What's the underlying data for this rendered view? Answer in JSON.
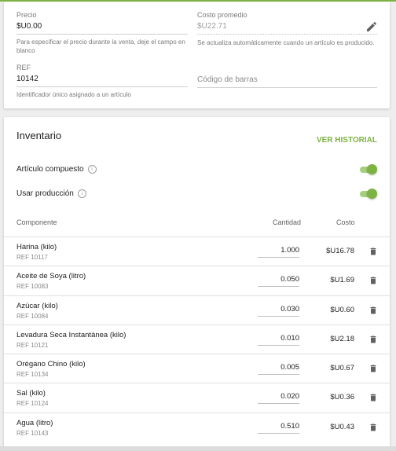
{
  "pricing": {
    "price_label": "Precio",
    "price_value": "$U0.00",
    "price_hint": "Para especificar el precio durante la venta, deje el campo en blanco",
    "avg_cost_label": "Costo promedio",
    "avg_cost_value": "$U22.71",
    "avg_cost_hint": "Se actualiza automáticamente cuando un artículo es producido.",
    "ref_label": "REF",
    "ref_value": "10142",
    "ref_hint": "Identificador único asignado a un artículo",
    "barcode_placeholder": "Código de barras"
  },
  "inventory": {
    "title": "Inventario",
    "history_link": "VER HISTORIAL",
    "composite_label": "Artículo compuesto",
    "composite_on": true,
    "production_label": "Usar producción",
    "production_on": true,
    "accent_color": "#7cb342"
  },
  "table": {
    "col_component": "Componente",
    "col_quantity": "Cantidad",
    "col_cost": "Costo",
    "rows": [
      {
        "name": "Harina (kilo)",
        "ref": "REF 10117",
        "qty": "1.000",
        "cost": "$U16.78"
      },
      {
        "name": "Aceite de Soya (litro)",
        "ref": "REF 10083",
        "qty": "0.050",
        "cost": "$U1.69"
      },
      {
        "name": "Azúcar (kilo)",
        "ref": "REF 10084",
        "qty": "0.030",
        "cost": "$U0.60"
      },
      {
        "name": "Levadura Seca Instantánea (kilo)",
        "ref": "REF 10121",
        "qty": "0.010",
        "cost": "$U2.18"
      },
      {
        "name": "Orégano Chino (kilo)",
        "ref": "REF 10134",
        "qty": "0.005",
        "cost": "$U0.67"
      },
      {
        "name": "Sal (kilo)",
        "ref": "REF 10124",
        "qty": "0.020",
        "cost": "$U0.36"
      },
      {
        "name": "Agua (litro)",
        "ref": "REF 10143",
        "qty": "0.510",
        "cost": "$U0.43"
      }
    ]
  }
}
